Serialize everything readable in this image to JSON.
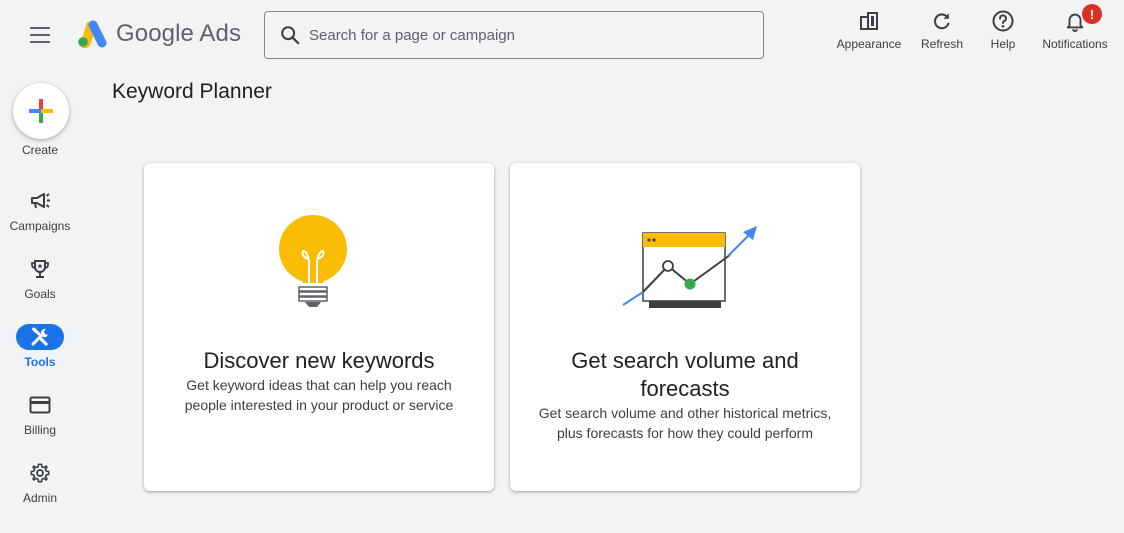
{
  "app": {
    "brand_name": "Google Ads",
    "page_title": "Keyword Planner"
  },
  "search": {
    "placeholder": "Search for a page or campaign",
    "value": ""
  },
  "top_actions": [
    {
      "label": "Appearance",
      "icon": "appearance-icon"
    },
    {
      "label": "Refresh",
      "icon": "refresh-icon"
    },
    {
      "label": "Help",
      "icon": "help-icon"
    },
    {
      "label": "Notifications",
      "icon": "bell-icon",
      "badge": "!"
    }
  ],
  "sidenav": {
    "create_label": "Create",
    "items": [
      {
        "label": "Campaigns",
        "icon": "megaphone-icon",
        "active": false
      },
      {
        "label": "Goals",
        "icon": "trophy-icon",
        "active": false
      },
      {
        "label": "Tools",
        "icon": "tools-icon",
        "active": true
      },
      {
        "label": "Billing",
        "icon": "credit-card-icon",
        "active": false
      },
      {
        "label": "Admin",
        "icon": "gear-icon",
        "active": false
      }
    ]
  },
  "cards": [
    {
      "title": "Discover new keywords",
      "description": "Get keyword ideas that can help you reach people interested in your product or service",
      "illustration": "lightbulb-icon"
    },
    {
      "title": "Get search volume and forecasts",
      "description": "Get search volume and other historical metrics, plus forecasts for how they could perform",
      "illustration": "forecast-chart-icon"
    }
  ],
  "colors": {
    "background": "#f1f3f4",
    "accent": "#1a73e8",
    "badge": "#d93025",
    "bulb": "#fbbc04",
    "google_green": "#34a853"
  }
}
